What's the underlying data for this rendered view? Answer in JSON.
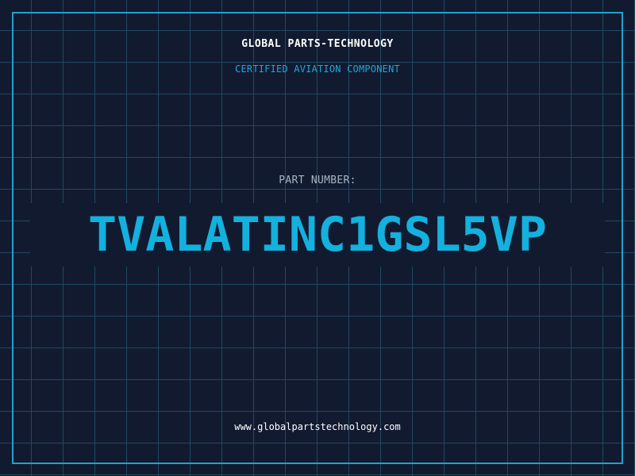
{
  "header": {
    "company": "GLOBAL PARTS-TECHNOLOGY",
    "tagline": "CERTIFIED AVIATION COMPONENT"
  },
  "part": {
    "label": "PART NUMBER:",
    "number": "TVALATINC1GSL5VP"
  },
  "footer": {
    "url": "www.globalpartstechnology.com"
  },
  "colors": {
    "background": "#121a30",
    "grid": "#1f4a60",
    "accent": "#1fa3cc",
    "part_number": "#14b0de",
    "label": "#a9b4c4",
    "text": "#ffffff"
  }
}
